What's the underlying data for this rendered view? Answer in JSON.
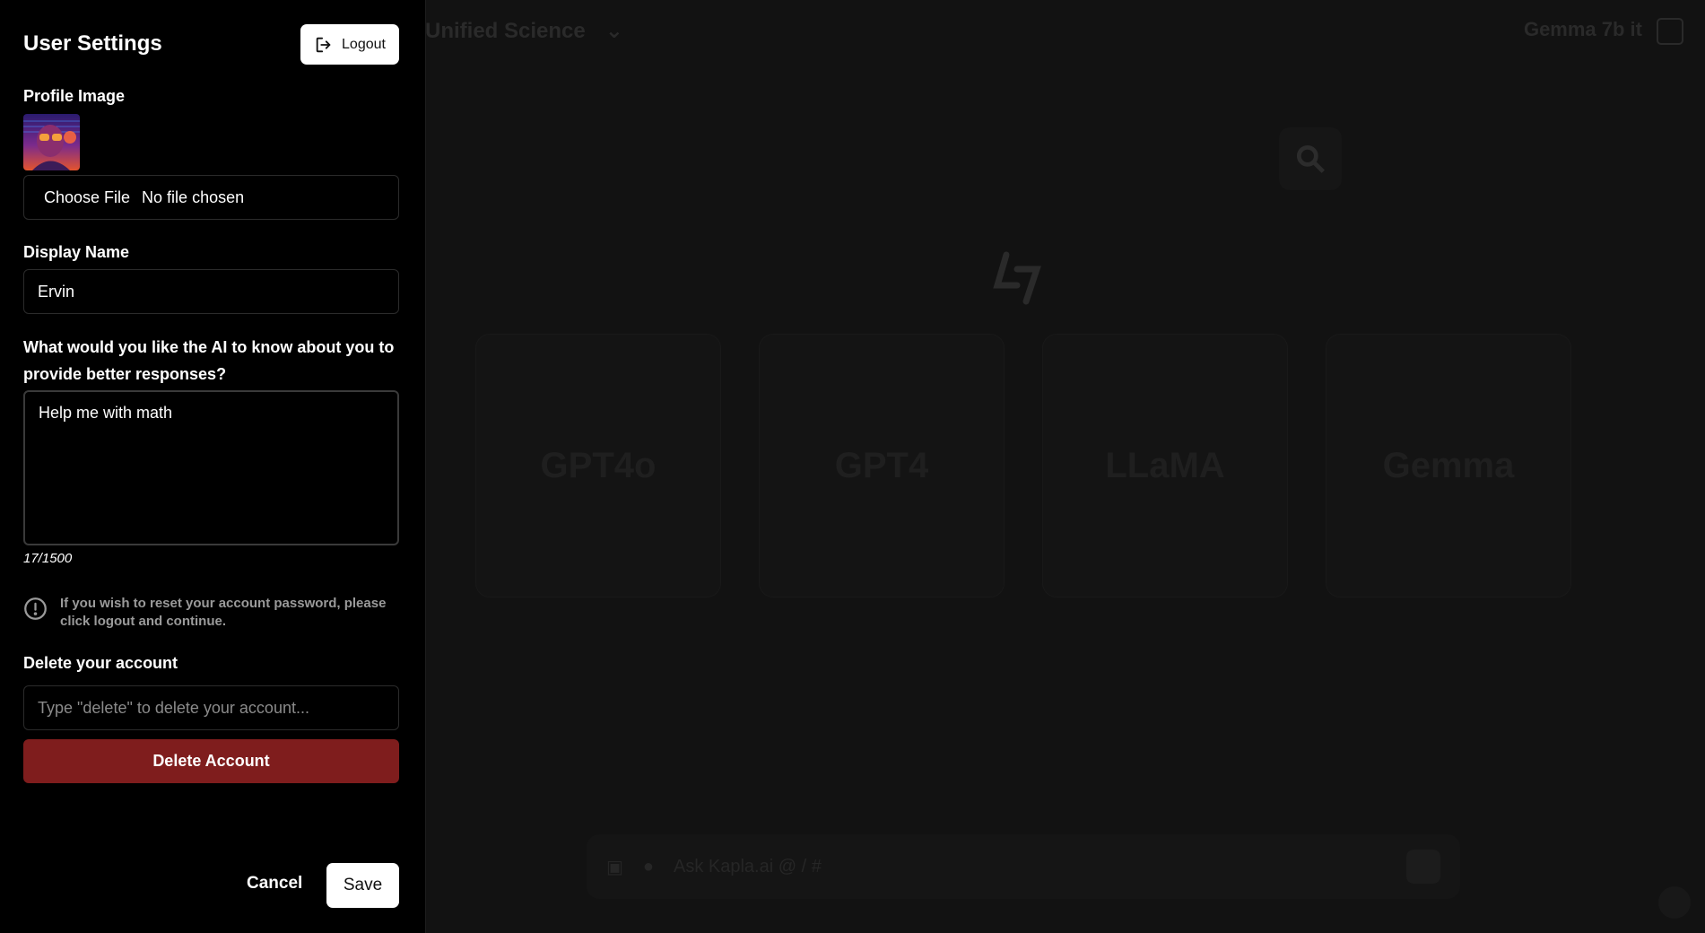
{
  "background": {
    "model_selector": "Unified Science",
    "header_right": "Gemma 7b it",
    "model_cards": [
      "GPT4o",
      "GPT4",
      "LLaMA",
      "Gemma"
    ],
    "input_placeholder": "Ask Kapla.ai @ / #"
  },
  "settings": {
    "title": "User Settings",
    "logout_label": "Logout",
    "profile_image_label": "Profile Image",
    "choose_file_label": "Choose File",
    "file_status": "No file chosen",
    "display_name_label": "Display Name",
    "display_name_value": "Ervin",
    "about_question": "What would you like the AI to know about you to provide better responses?",
    "about_value": "Help me with math",
    "char_counter": "17/1500",
    "password_notice": "If you wish to reset your account password, please click logout and continue.",
    "delete_section_label": "Delete your account",
    "delete_placeholder": "Type \"delete\" to delete your account...",
    "delete_button_label": "Delete Account",
    "cancel_label": "Cancel",
    "save_label": "Save"
  },
  "colors": {
    "panel_bg": "#000000",
    "danger": "#7f1d1d",
    "primary_button_bg": "#ffffff"
  }
}
